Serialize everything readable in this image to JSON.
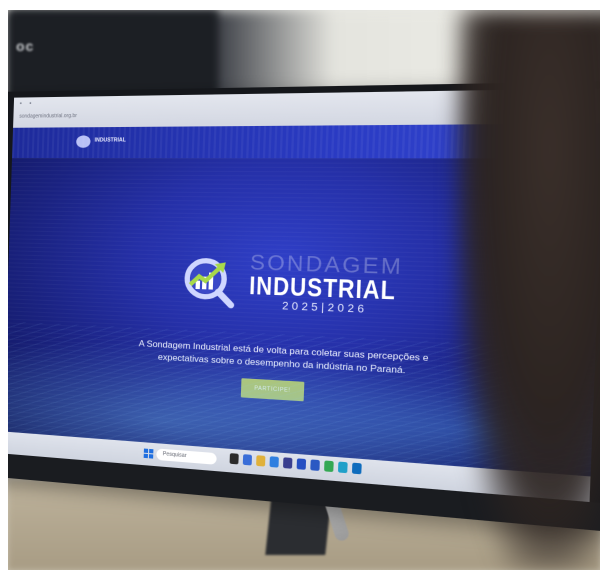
{
  "browser": {
    "url": "sondagemindustrial.org.br",
    "tab_dots": "• •",
    "toolbar_icons": "☆ ⋮"
  },
  "site": {
    "header_name": "INDUSTRIAL",
    "brand_top": "SONDAGEM",
    "brand_main": "INDUSTRIAL",
    "brand_year": "2025|2026",
    "tagline": "A Sondagem Industrial está de volta para coletar suas percepções e expectativas sobre o desempenho da indústria no Paraná.",
    "cta_label": "PARTICIPE!"
  },
  "taskbar": {
    "search_placeholder": "Pesquisar",
    "icons": [
      "file-explorer-icon",
      "browser-icon",
      "mail-icon",
      "store-icon",
      "photos-icon",
      "settings-icon",
      "word-icon",
      "chrome-icon",
      "edge-icon",
      "outlook-icon"
    ]
  },
  "colors": {
    "hero_blue": "#2530a8",
    "cta_green": "#b9c760",
    "header_blue": "#2a3bc4",
    "emblem_accent": "#a8d94a"
  }
}
